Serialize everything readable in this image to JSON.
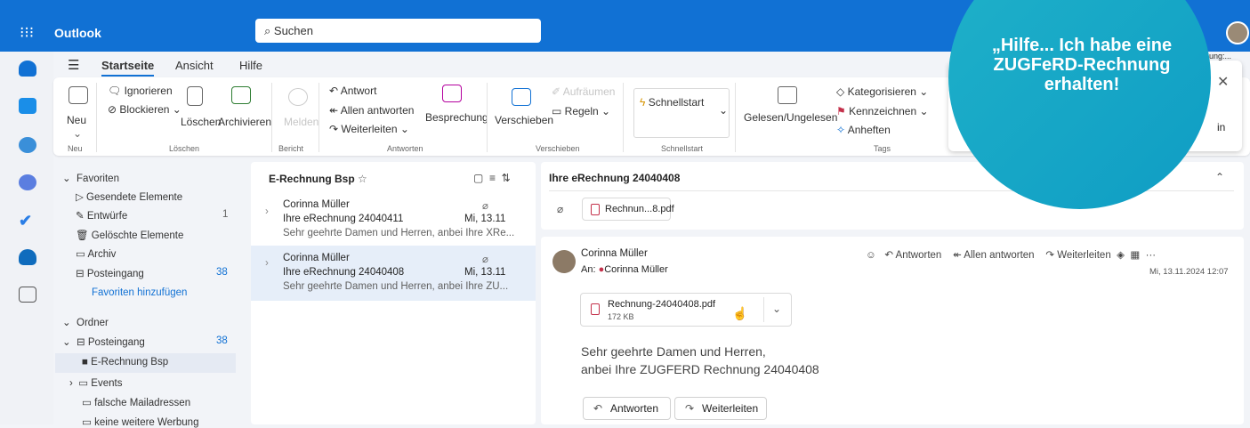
{
  "app": {
    "title": "Outlook",
    "search_placeholder": "Suchen"
  },
  "menu": {
    "tabs": [
      "Startseite",
      "Ansicht",
      "Hilfe"
    ]
  },
  "ribbon": {
    "neu": "Neu",
    "ignorieren": "Ignorieren",
    "blockieren": "Blockieren",
    "loeschen": "Löschen",
    "archivieren": "Archivieren",
    "melden": "Melden",
    "antwort": "Antwort",
    "allen_antworten": "Allen antworten",
    "weiterleiten": "Weiterleiten",
    "besprechung": "Besprechung",
    "verschieben": "Verschieben",
    "aufraeumen": "Aufräumen",
    "regeln": "Regeln",
    "schnellstart": "Schnellstart",
    "gelesen": "Gelesen/Ungelesen",
    "kategorisieren": "Kategorisieren",
    "kennzeichnen": "Kennzeichnen",
    "anheften": "Anheften",
    "groups": {
      "neu": "Neu",
      "loeschen": "Löschen",
      "bericht": "Bericht",
      "antworten": "Antworten",
      "verschieben": "Verschieben",
      "schnellstart": "Schnellstart",
      "tags": "Tags"
    }
  },
  "folders": {
    "favoriten": "Favoriten",
    "gesendet": "Gesendete Elemente",
    "entwuerfe": "Entwürfe",
    "entwuerfe_count": "1",
    "geloescht": "Gelöschte Elemente",
    "archiv": "Archiv",
    "posteingang": "Posteingang",
    "posteingang_count": "38",
    "fav_add": "Favoriten hinzufügen",
    "ordner": "Ordner",
    "posteingang2": "Posteingang",
    "posteingang2_count": "38",
    "erechnung": "E-Rechnung Bsp",
    "events": "Events",
    "falsche": "falsche Mailadressen",
    "keine": "keine weitere Werbung"
  },
  "list": {
    "title": "E-Rechnung Bsp",
    "messages": [
      {
        "sender": "Corinna Müller",
        "subject": "Ihre eRechnung 24040411",
        "date": "Mi, 13.11",
        "preview": "Sehr geehrte Damen und Herren, anbei Ihre XRe..."
      },
      {
        "sender": "Corinna Müller",
        "subject": "Ihre eRechnung 24040408",
        "date": "Mi, 13.11",
        "preview": "Sehr geehrte Damen und Herren, anbei Ihre ZU..."
      }
    ]
  },
  "reading": {
    "subject": "Ihre eRechnung 24040408",
    "attachment_short": "Rechnun...8.pdf",
    "sender": "Corinna Müller",
    "to_label": "An:",
    "to": "Corinna Müller",
    "antworten": "Antworten",
    "allen_antworten": "Allen antworten",
    "weiterleiten": "Weiterleiten",
    "date": "Mi, 13.11.2024 12:07",
    "attachment_name": "Rechnung-24040408.pdf",
    "attachment_size": "172 KB",
    "body_line1": "Sehr geehrte Damen und Herren,",
    "body_line2": "anbei Ihre ZUGFERD Rechnung 24040408",
    "btn_antworten": "Antworten",
    "btn_weiterleiten": "Weiterleiten"
  },
  "notification": {
    "partial1": "hnung:...",
    "partial2": "in"
  },
  "overlay": {
    "text": "„Hilfe... Ich habe eine ZUGFeRD-Rechnung erhalten!"
  },
  "colors": {
    "brand": "#1171d4",
    "accent_circle": "#15a6c6",
    "selected": "#e6eef9"
  }
}
